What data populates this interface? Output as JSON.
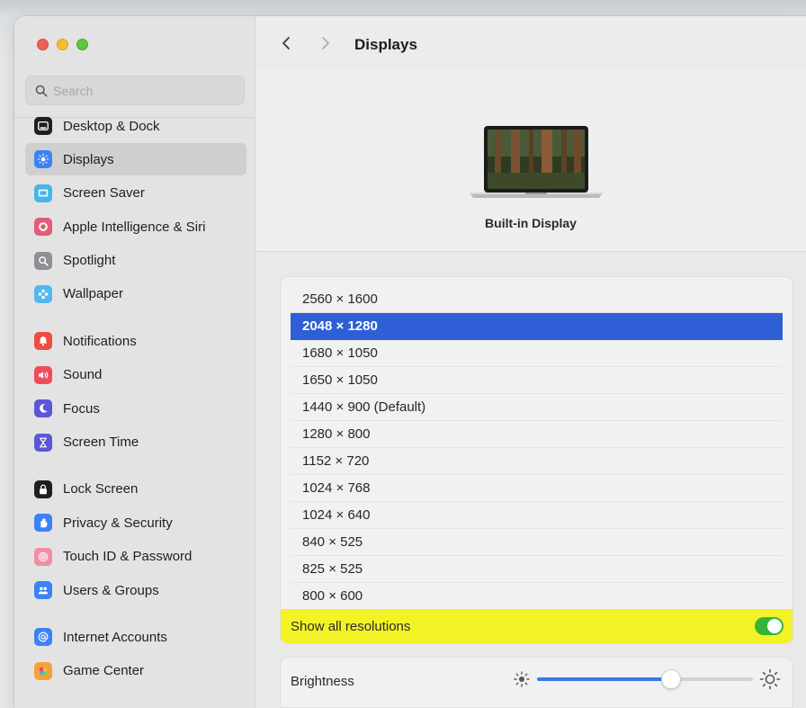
{
  "window": {
    "title": "Displays"
  },
  "search": {
    "placeholder": "Search",
    "value": ""
  },
  "sidebar": {
    "items": [
      {
        "label": "Desktop & Dock",
        "icon": "dock-icon",
        "color": "#1f1f1f",
        "selected": false
      },
      {
        "label": "Displays",
        "icon": "sun-icon",
        "color": "#3b82f6",
        "selected": true
      },
      {
        "label": "Screen Saver",
        "icon": "screensaver-icon",
        "color": "#47b5e8",
        "selected": false
      },
      {
        "label": "Apple Intelligence & Siri",
        "icon": "siri-icon",
        "color": "#e55c7a",
        "selected": false
      },
      {
        "label": "Spotlight",
        "icon": "magnifier-icon",
        "color": "#8e8e93",
        "selected": false
      },
      {
        "label": "Wallpaper",
        "icon": "flower-icon",
        "color": "#52b8ef",
        "selected": false
      },
      {
        "label": "Notifications",
        "icon": "bell-icon",
        "color": "#ef4b45",
        "selected": false
      },
      {
        "label": "Sound",
        "icon": "speaker-icon",
        "color": "#ef4b5c",
        "selected": false
      },
      {
        "label": "Focus",
        "icon": "moon-icon",
        "color": "#5b57d6",
        "selected": false
      },
      {
        "label": "Screen Time",
        "icon": "hourglass-icon",
        "color": "#5b57d6",
        "selected": false
      },
      {
        "label": "Lock Screen",
        "icon": "lock-icon",
        "color": "#1f1f1f",
        "selected": false
      },
      {
        "label": "Privacy & Security",
        "icon": "hand-icon",
        "color": "#3b82f6",
        "selected": false
      },
      {
        "label": "Touch ID & Password",
        "icon": "fingerprint-icon",
        "color": "#ef8ea3",
        "selected": false
      },
      {
        "label": "Users & Groups",
        "icon": "users-icon",
        "color": "#3b82f6",
        "selected": false
      },
      {
        "label": "Internet Accounts",
        "icon": "at-icon",
        "color": "#3b82f6",
        "selected": false
      },
      {
        "label": "Game Center",
        "icon": "gamecenter-icon",
        "color": "#f3a23a",
        "selected": false
      }
    ]
  },
  "header": {
    "display_name": "Built-in Display"
  },
  "resolutions": {
    "items": [
      "2560 × 1600",
      "2048 × 1280",
      "1680 × 1050",
      "1650 × 1050",
      "1440 × 900 (Default)",
      "1280 × 800",
      "1152 × 720",
      "1024 × 768",
      "1024 × 640",
      "840 × 525",
      "825 × 525",
      "800 × 600"
    ],
    "selected": "2048 × 1280",
    "show_all_label": "Show all resolutions",
    "show_all_on": true,
    "highlight_color": "#f3f226"
  },
  "brightness": {
    "label": "Brightness",
    "level": 0.62
  },
  "colors": {
    "accent": "#2f5fd6",
    "toggle_on": "#34b53a"
  }
}
